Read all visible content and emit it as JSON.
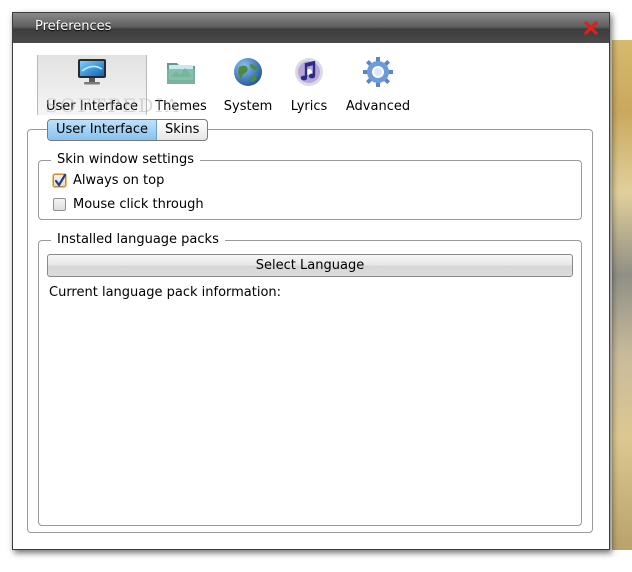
{
  "window": {
    "title": "Preferences"
  },
  "toolbar": {
    "items": [
      {
        "label": "User Interface",
        "icon": "monitor-icon",
        "active": true
      },
      {
        "label": "Themes",
        "icon": "folder-icon",
        "active": false
      },
      {
        "label": "System",
        "icon": "globe-icon",
        "active": false
      },
      {
        "label": "Lyrics",
        "icon": "music-note-icon",
        "active": false
      },
      {
        "label": "Advanced",
        "icon": "gear-icon",
        "active": false
      }
    ]
  },
  "watermark": "SOFTPEDIA",
  "subtabs": [
    {
      "label": "User Interface",
      "active": true
    },
    {
      "label": "Skins",
      "active": false
    }
  ],
  "skin_group": {
    "legend": "Skin window settings",
    "options": [
      {
        "label": "Always on top",
        "checked": true
      },
      {
        "label": "Mouse click through",
        "checked": false
      }
    ]
  },
  "language_group": {
    "legend": "Installed language packs",
    "button_label": "Select Language",
    "info_label": "Current language pack information:"
  },
  "colors": {
    "close": "#e0201b",
    "accent_tab": "#86c3f0"
  }
}
